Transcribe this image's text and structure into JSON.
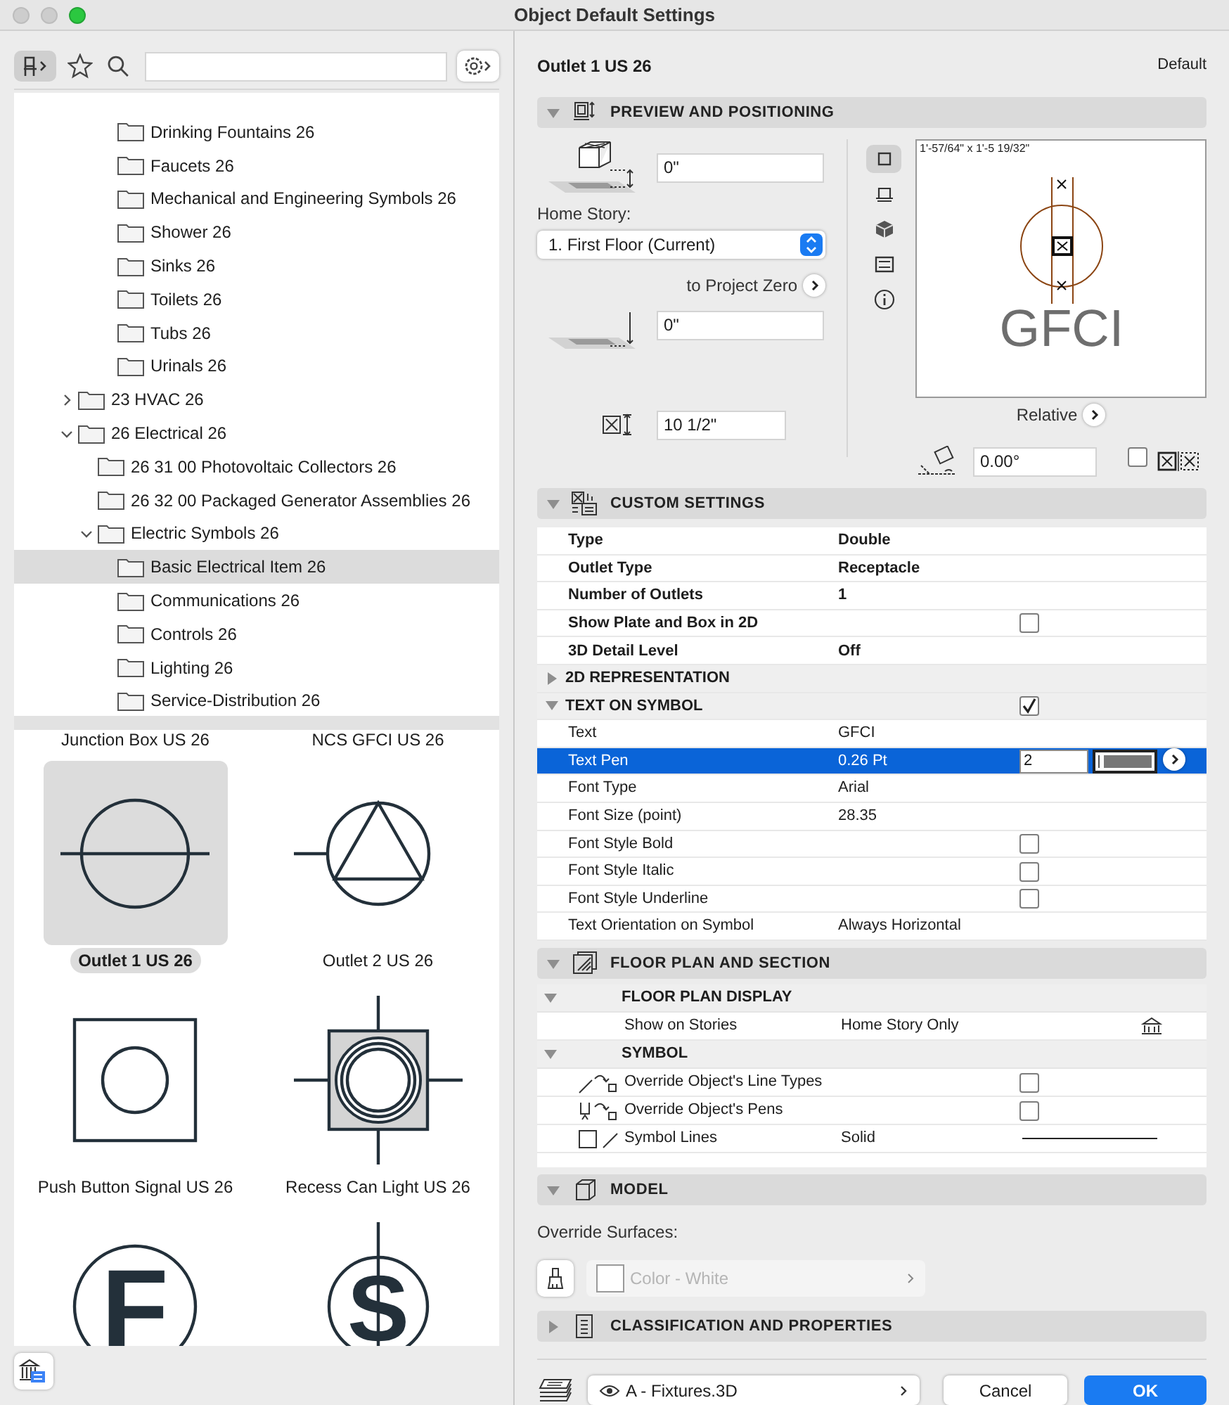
{
  "window": {
    "title": "Object Default Settings"
  },
  "library": {
    "tree": {
      "scrolled_items": [
        {
          "label": "Drinking Fountains 26",
          "selected": false
        },
        {
          "label": "Faucets 26",
          "selected": false
        },
        {
          "label": "Mechanical and Engineering Symbols 26",
          "selected": false
        },
        {
          "label": "Shower 26",
          "selected": false
        },
        {
          "label": "Sinks 26",
          "selected": false
        },
        {
          "label": "Toilets 26",
          "selected": false
        },
        {
          "label": "Tubs 26",
          "selected": false
        },
        {
          "label": "Urinals 26",
          "selected": false
        }
      ],
      "items": [
        {
          "label": "23 HVAC 26",
          "expanded": false,
          "selected": false
        },
        {
          "label": "26 Electrical 26",
          "expanded": true,
          "selected": false,
          "children": [
            {
              "label": "26 31 00 Photovoltaic Collectors 26",
              "selected": false
            },
            {
              "label": "26 32 00 Packaged Generator Assemblies 26",
              "selected": false
            },
            {
              "label": "Electric Symbols 26",
              "expanded": true,
              "selected": false,
              "children": [
                {
                  "label": "Basic Electrical Item 26",
                  "selected": true
                },
                {
                  "label": "Communications 26",
                  "selected": false
                },
                {
                  "label": "Controls 26",
                  "selected": false
                },
                {
                  "label": "Lighting 26",
                  "selected": false
                },
                {
                  "label": "Service-Distribution 26",
                  "selected": false
                }
              ]
            }
          ]
        }
      ]
    },
    "gallery": [
      {
        "kind": "caption",
        "label": "Junction Box US 26",
        "selected": false
      },
      {
        "kind": "caption",
        "label": "NCS GFCI US 26",
        "selected": false
      },
      {
        "kind": "outlet-line",
        "label": "Outlet 1 US 26",
        "selected": true
      },
      {
        "kind": "outlet-triangle",
        "label": "Outlet 2 US 26",
        "selected": false
      },
      {
        "kind": "square-circle",
        "label": "Push Button Signal US 26",
        "selected": false
      },
      {
        "kind": "recessed-light",
        "label": "Recess Can Light US 26",
        "selected": false
      },
      {
        "kind": "letter-circle",
        "glyph": "F",
        "selected": false
      },
      {
        "kind": "letter-circle-stem",
        "glyph": "S",
        "selected": false
      }
    ]
  },
  "settings": {
    "object_name": "Outlet 1 US 26",
    "profile": "Default",
    "preview": {
      "title": "PREVIEW AND POSITIONING",
      "expanded": true,
      "elevation": "0\"",
      "home_story_label": "Home Story:",
      "home_story": "1. First Floor (Current)",
      "reference_label": "to Project Zero",
      "reference_elevation": "0\"",
      "height": "10 1/2\"",
      "views": [
        {
          "kind": "plan",
          "selected": true
        },
        {
          "kind": "section",
          "selected": false
        },
        {
          "kind": "cube",
          "selected": false
        },
        {
          "kind": "elevation",
          "selected": false
        },
        {
          "kind": "info",
          "selected": false
        }
      ],
      "size_text": "1'-57/64\" x 1'-5 19/32\"",
      "symbol_text": "GFCI",
      "anchor_label": "Relative",
      "angle": "0.00°",
      "mirrored": false
    },
    "custom": {
      "title": "CUSTOM SETTINGS",
      "expanded": true,
      "rows": [
        {
          "kind": "value",
          "label": "Type",
          "value": "Double",
          "bold": true,
          "selected": false
        },
        {
          "kind": "value",
          "label": "Outlet Type",
          "value": "Receptacle",
          "bold": true,
          "selected": false
        },
        {
          "kind": "value",
          "label": "Number of Outlets",
          "value": "1",
          "bold": true,
          "selected": false
        },
        {
          "kind": "checkbox",
          "label": "Show Plate and Box in 2D",
          "checked": false,
          "bold": true,
          "selected": false
        },
        {
          "kind": "value",
          "label": "3D Detail Level",
          "value": "Off",
          "bold": true,
          "selected": false
        },
        {
          "kind": "group",
          "label": "2D REPRESENTATION",
          "expanded": false,
          "selected": false
        },
        {
          "kind": "group",
          "label": "TEXT ON SYMBOL",
          "expanded": true,
          "checked": true,
          "selected": false
        },
        {
          "kind": "value",
          "label": "Text",
          "value": "GFCI",
          "bold": false,
          "selected": false
        },
        {
          "kind": "pen",
          "label": "Text Pen",
          "value": "0.26 Pt",
          "pen": "2",
          "bold": false,
          "selected": true
        },
        {
          "kind": "value",
          "label": "Font Type",
          "value": "Arial",
          "bold": false,
          "selected": false
        },
        {
          "kind": "value",
          "label": "Font Size (point)",
          "value": "28.35",
          "bold": false,
          "selected": false
        },
        {
          "kind": "checkbox",
          "label": "Font Style Bold",
          "checked": false,
          "bold": false,
          "selected": false
        },
        {
          "kind": "checkbox",
          "label": "Font Style Italic",
          "checked": false,
          "bold": false,
          "selected": false
        },
        {
          "kind": "checkbox",
          "label": "Font Style Underline",
          "checked": false,
          "bold": false,
          "selected": false
        },
        {
          "kind": "value",
          "label": "Text Orientation on Symbol",
          "value": "Always Horizontal",
          "bold": false,
          "selected": false
        }
      ]
    },
    "floor_plan": {
      "title": "FLOOR PLAN AND SECTION",
      "expanded": true,
      "groups": [
        {
          "label": "FLOOR PLAN DISPLAY",
          "expanded": true,
          "rows": [
            {
              "kind": "stories",
              "label": "Show on Stories",
              "value": "Home Story Only"
            }
          ]
        },
        {
          "label": "SYMBOL",
          "expanded": true,
          "rows": [
            {
              "kind": "checkbox",
              "label": "Override Object's Line Types",
              "checked": false
            },
            {
              "kind": "checkbox",
              "label": "Override Object's Pens",
              "checked": false
            },
            {
              "kind": "line",
              "label": "Symbol Lines",
              "value": "Solid"
            }
          ]
        }
      ]
    },
    "model": {
      "title": "MODEL",
      "expanded": true,
      "override_label": "Override Surfaces:",
      "surface": "Color - White",
      "surface_disabled": true
    },
    "classification": {
      "title": "CLASSIFICATION AND PROPERTIES",
      "expanded": false
    }
  },
  "footer": {
    "layer": "A - Fixtures.3D",
    "cancel": "Cancel",
    "ok": "OK"
  }
}
